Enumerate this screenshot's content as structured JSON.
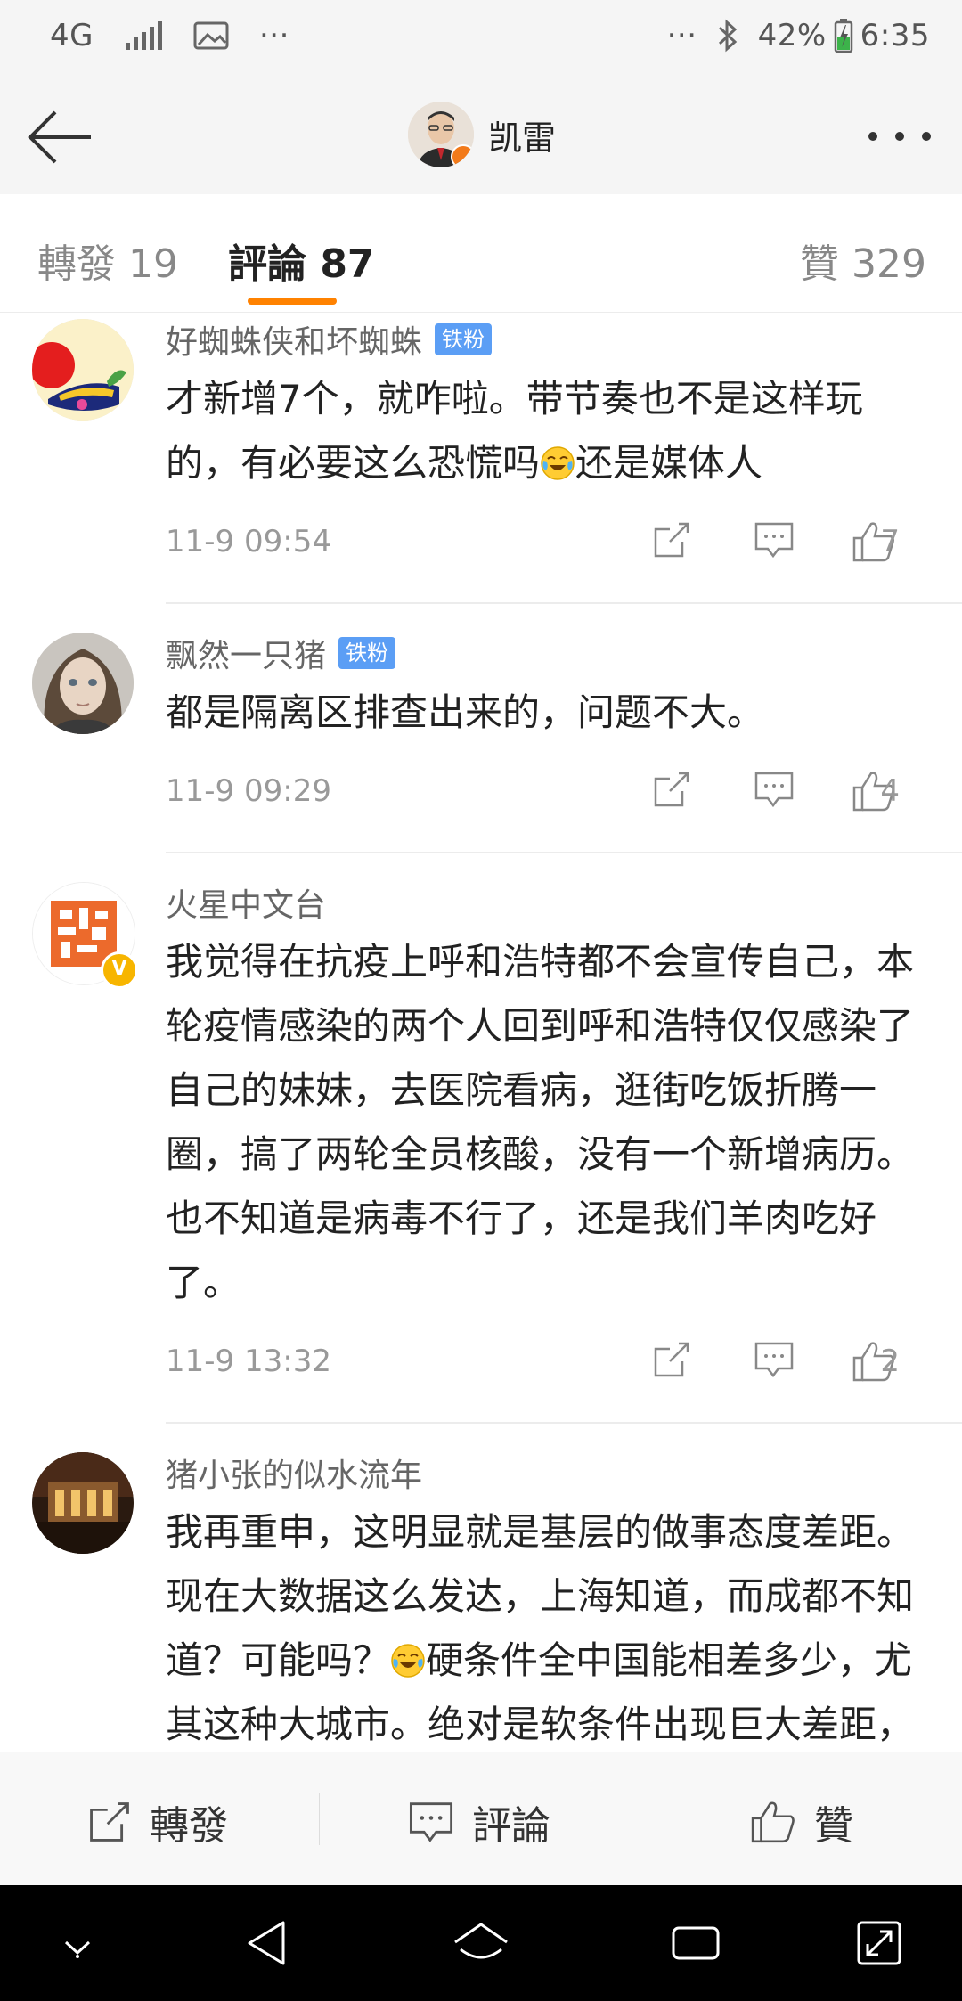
{
  "status_bar": {
    "network": "4G",
    "dots_left": "···",
    "dots_right": "···",
    "battery": "42%",
    "time": "6:35"
  },
  "header": {
    "title": "凯雷"
  },
  "tabs": {
    "repost": "轉發 19",
    "comment": "評論 87",
    "like": "贊 329"
  },
  "comments": [
    {
      "name": "好蜘蛛侠和坏蜘蛛",
      "badge": "铁粉",
      "text_a": "才新增7个，就咋啦。带节奏也不是这样玩的，有必要这么恐慌吗",
      "text_b": "还是媒体人",
      "time": "11-9 09:54",
      "likes": "7"
    },
    {
      "name": "飘然一只猪",
      "badge": "铁粉",
      "text": "都是隔离区排查出来的，问题不大。",
      "time": "11-9 09:29",
      "likes": "4"
    },
    {
      "name": "火星中文台",
      "verified": "V",
      "text": "我觉得在抗疫上呼和浩特都不会宣传自己，本轮疫情感染的两个人回到呼和浩特仅仅感染了自己的妹妹，去医院看病，逛街吃饭折腾一圈，搞了两轮全员核酸，没有一个新增病历。也不知道是病毒不行了，还是我们羊肉吃好了。",
      "time": "11-9 13:32",
      "likes": "2"
    },
    {
      "name": "猪小张的似水流年",
      "text_a": "我再重申，这明显就是基层的做事态度差距。现在大数据这么发达，上海知道，而成都不知道？可能吗？",
      "text_b": "硬条件全中国能相差多少，尤其这种大城市。绝对是软条件出现巨大差距，多少人在尸位素餐？还说中国的"
    }
  ],
  "action_bar": {
    "repost": "轉發",
    "comment": "評論",
    "like": "贊"
  }
}
